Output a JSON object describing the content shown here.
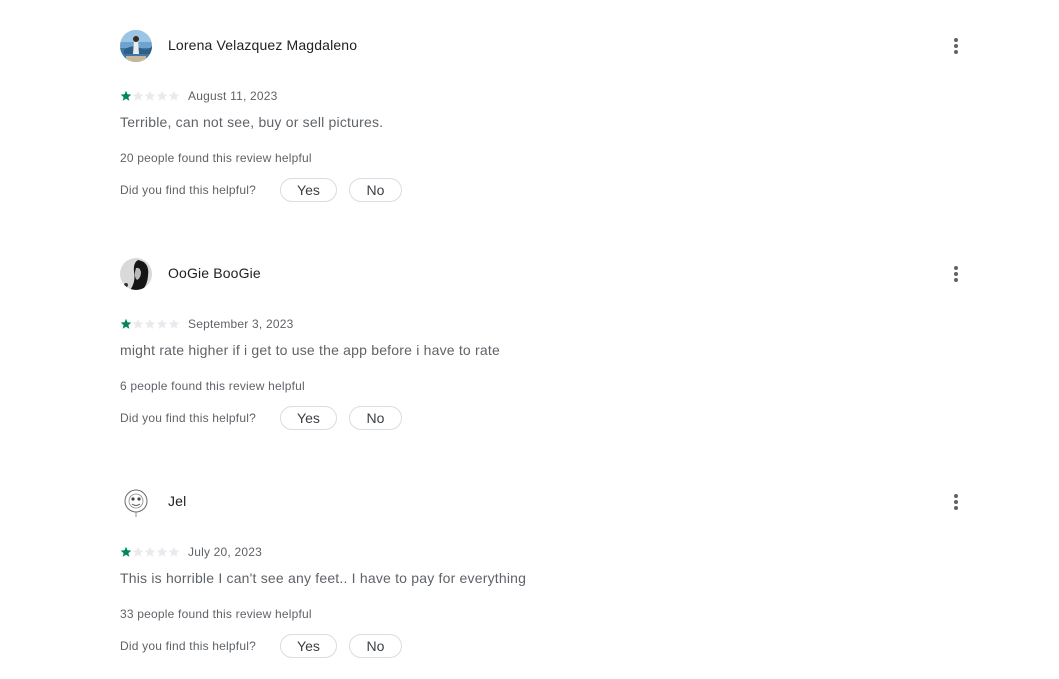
{
  "icons": {
    "more": "more-vert-icon",
    "star": "star-icon"
  },
  "colors": {
    "star_filled": "#01875f",
    "star_empty": "#e8eaed",
    "author_text": "#202124",
    "secondary_text": "#5f6368",
    "pill_border": "#dadce0"
  },
  "reviews": [
    {
      "author": "Lorena Velazquez Magdaleno",
      "rating": 1,
      "max_rating": 5,
      "date": "August 11, 2023",
      "text": "Terrible, can not see, buy or sell pictures.",
      "helpful_count": "20 people found this review helpful",
      "helpful_question": "Did you find this helpful?",
      "yes_label": "Yes",
      "no_label": "No"
    },
    {
      "author": "OoGie BooGie",
      "rating": 1,
      "max_rating": 5,
      "date": "September 3, 2023",
      "text": "might rate higher if i get to use the app before i have to rate",
      "helpful_count": "6 people found this review helpful",
      "helpful_question": "Did you find this helpful?",
      "yes_label": "Yes",
      "no_label": "No"
    },
    {
      "author": "Jel",
      "rating": 1,
      "max_rating": 5,
      "date": "July 20, 2023",
      "text": "This is horrible I can't see any feet.. I have to pay for everything",
      "helpful_count": "33 people found this review helpful",
      "helpful_question": "Did you find this helpful?",
      "yes_label": "Yes",
      "no_label": "No"
    }
  ]
}
